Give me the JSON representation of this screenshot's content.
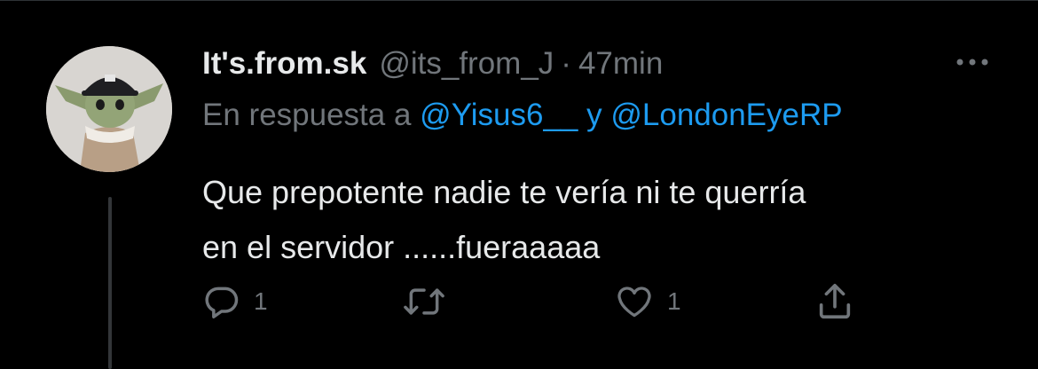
{
  "tweet": {
    "display_name": "It's.from.sk",
    "handle": "@its_from_J",
    "separator": "·",
    "time": "47min",
    "reply_prefix": "En respuesta a",
    "reply_mention_1": "@Yisus6__",
    "reply_conjunction": "y",
    "reply_mention_2": "@LondonEyeRP",
    "text_line_1": "Que prepotente nadie te vería ni te querría",
    "text_line_2": "en el servidor ......fueraaaaa",
    "reply_count": "1",
    "like_count": "1"
  },
  "icons": {
    "more": "more-horizontal-icon",
    "reply": "reply-bubble-icon",
    "retweet": "retweet-icon",
    "like": "heart-icon",
    "share": "share-icon"
  },
  "colors": {
    "background": "#000000",
    "primary_text": "#e7e9ea",
    "secondary_text": "#71767b",
    "link": "#1d9bf0",
    "divider": "#2f3336"
  }
}
